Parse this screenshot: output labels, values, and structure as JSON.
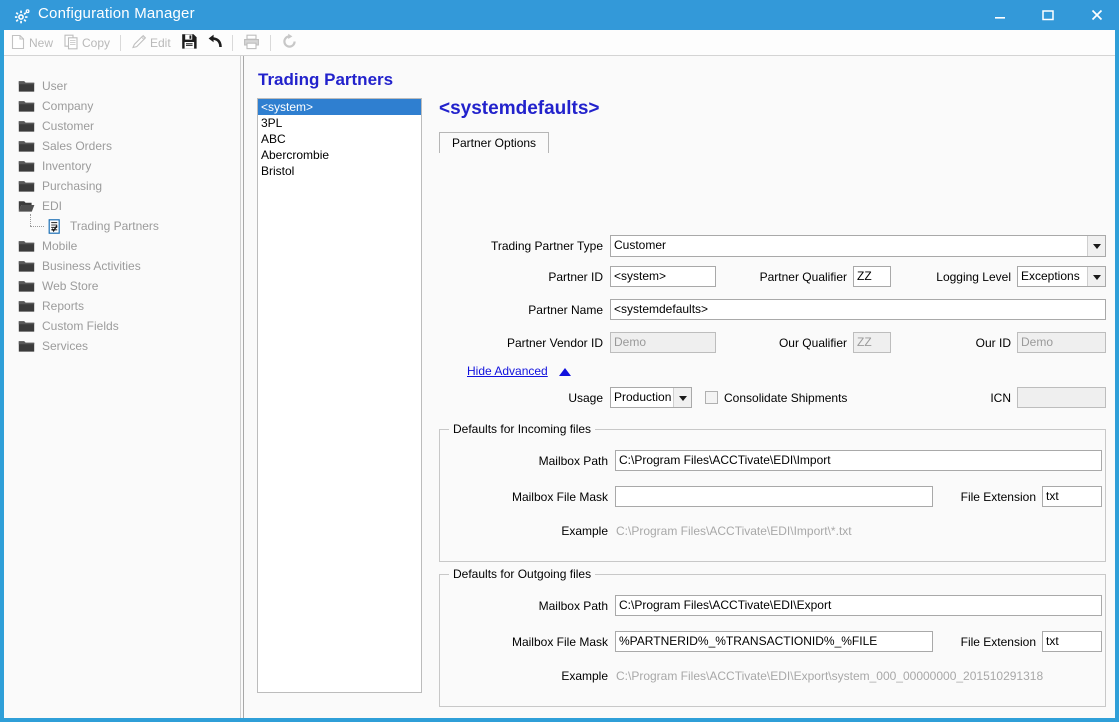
{
  "window": {
    "title": "Configuration Manager",
    "icon": "gear-icon",
    "minimize_label": "Minimize",
    "maximize_label": "Maximize",
    "close_label": "Close"
  },
  "toolbar": {
    "items": [
      {
        "label": "New",
        "icon": "new-document-icon",
        "enabled": false
      },
      {
        "label": "Copy",
        "icon": "copy-icon",
        "enabled": false
      },
      {
        "label": "Edit",
        "icon": "pencil-icon",
        "enabled": false
      },
      {
        "label": "",
        "icon": "save-icon",
        "enabled": true
      },
      {
        "label": "",
        "icon": "undo-icon",
        "enabled": true
      },
      {
        "label": "",
        "icon": "print-icon",
        "enabled": false
      },
      {
        "label": "",
        "icon": "refresh-icon",
        "enabled": false
      }
    ]
  },
  "sidebar": {
    "items": [
      {
        "label": "User",
        "icon": "folder-icon",
        "level": 0
      },
      {
        "label": "Company",
        "icon": "folder-icon",
        "level": 0
      },
      {
        "label": "Customer",
        "icon": "folder-icon",
        "level": 0
      },
      {
        "label": "Sales Orders",
        "icon": "folder-icon",
        "level": 0
      },
      {
        "label": "Inventory",
        "icon": "folder-icon",
        "level": 0
      },
      {
        "label": "Purchasing",
        "icon": "folder-icon",
        "level": 0
      },
      {
        "label": "EDI",
        "icon": "folder-open-icon",
        "level": 0
      },
      {
        "label": "Trading Partners",
        "icon": "document-list-icon",
        "level": 1
      },
      {
        "label": "Mobile",
        "icon": "folder-icon",
        "level": 0
      },
      {
        "label": "Business Activities",
        "icon": "folder-icon",
        "level": 0
      },
      {
        "label": "Web Store",
        "icon": "folder-icon",
        "level": 0
      },
      {
        "label": "Reports",
        "icon": "folder-icon",
        "level": 0
      },
      {
        "label": "Custom Fields",
        "icon": "folder-icon",
        "level": 0
      },
      {
        "label": "Services",
        "icon": "folder-icon",
        "level": 0
      }
    ]
  },
  "pane": {
    "title": "Trading Partners",
    "list": {
      "items": [
        "<system>",
        "3PL",
        "ABC",
        "Abercrombie",
        "Bristol"
      ],
      "selected_index": 0
    }
  },
  "record": {
    "title": "<systemdefaults>",
    "tabs": [
      {
        "label": "Partner Options",
        "active": true
      }
    ]
  },
  "form": {
    "trading_partner_type": {
      "label": "Trading Partner Type",
      "value": "Customer"
    },
    "partner_id": {
      "label": "Partner ID",
      "value": "<system>"
    },
    "partner_qualifier": {
      "label": "Partner Qualifier",
      "value": "ZZ"
    },
    "logging_level": {
      "label": "Logging Level",
      "value": "Exceptions"
    },
    "partner_name": {
      "label": "Partner Name",
      "value": "<systemdefaults>"
    },
    "partner_vendor_id": {
      "label": "Partner Vendor ID",
      "value": "Demo"
    },
    "our_qualifier": {
      "label": "Our Qualifier",
      "value": "ZZ"
    },
    "our_id": {
      "label": "Our ID",
      "value": "Demo"
    },
    "hide_advanced": {
      "label": "Hide Advanced"
    },
    "usage": {
      "label": "Usage",
      "value": "Production"
    },
    "consolidate_shipments": {
      "label": "Consolidate Shipments",
      "checked": false
    },
    "icn": {
      "label": "ICN",
      "value": ""
    }
  },
  "incoming": {
    "group_title": "Defaults for Incoming files",
    "mailbox_path": {
      "label": "Mailbox Path",
      "value": "C:\\Program Files\\ACCTivate\\EDI\\Import"
    },
    "mailbox_file_mask": {
      "label": "Mailbox File Mask",
      "value": ""
    },
    "file_extension": {
      "label": "File Extension",
      "value": "txt"
    },
    "example": {
      "label": "Example",
      "value": "C:\\Program Files\\ACCTivate\\EDI\\Import\\*.txt"
    }
  },
  "outgoing": {
    "group_title": "Defaults for Outgoing files",
    "mailbox_path": {
      "label": "Mailbox Path",
      "value": "C:\\Program Files\\ACCTivate\\EDI\\Export"
    },
    "mailbox_file_mask": {
      "label": "Mailbox File Mask",
      "value": "%PARTNERID%_%TRANSACTIONID%_%FILE"
    },
    "file_extension": {
      "label": "File Extension",
      "value": "txt"
    },
    "example": {
      "label": "Example",
      "value": "C:\\Program Files\\ACCTivate\\EDI\\Export\\system_000_00000000_201510291318"
    }
  },
  "colors": {
    "titlebar": "#3399d9",
    "accent_text": "#2222cc",
    "selection": "#2f7fd0",
    "link": "#1111dd"
  }
}
